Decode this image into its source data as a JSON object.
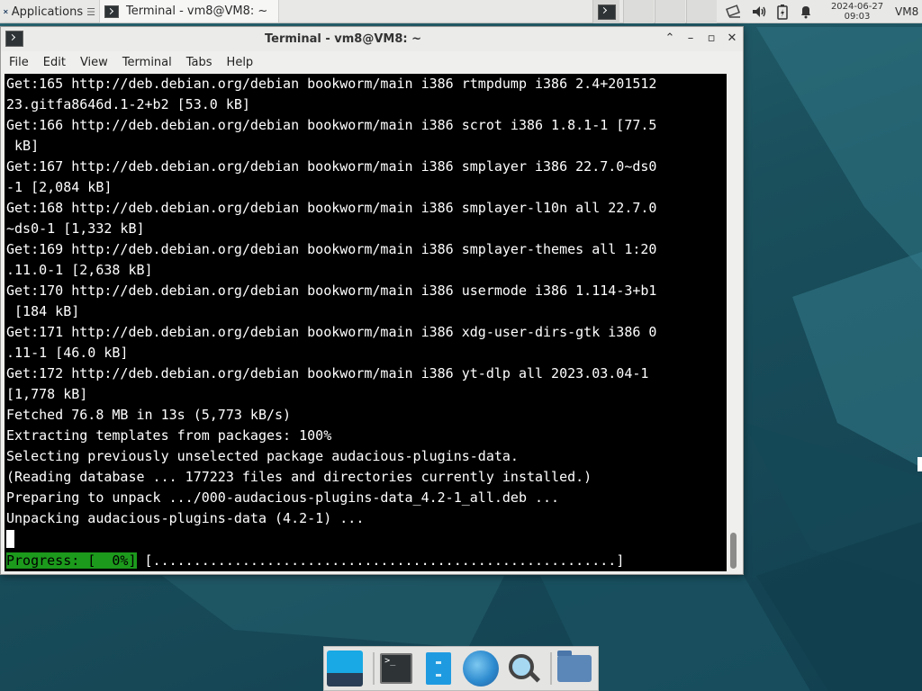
{
  "top_panel": {
    "applications_label": "Applications",
    "task_terminal_label": "Terminal - vm8@VM8: ~",
    "clock_date": "2024-06-27",
    "clock_time": "09:03",
    "user_label": "VM8",
    "tray_icons": [
      "network-icon",
      "volume-icon",
      "battery-icon",
      "notification-bell-icon"
    ]
  },
  "window": {
    "title": "Terminal - vm8@VM8: ~",
    "controls": {
      "shade": "⌃",
      "minimize": "–",
      "maximize": "▫",
      "close": "✕"
    }
  },
  "menubar": {
    "items": [
      "File",
      "Edit",
      "View",
      "Terminal",
      "Tabs",
      "Help"
    ]
  },
  "terminal": {
    "lines": [
      "Get:165 http://deb.debian.org/debian bookworm/main i386 rtmpdump i386 2.4+201512",
      "23.gitfa8646d.1-2+b2 [53.0 kB]",
      "Get:166 http://deb.debian.org/debian bookworm/main i386 scrot i386 1.8.1-1 [77.5",
      " kB]",
      "Get:167 http://deb.debian.org/debian bookworm/main i386 smplayer i386 22.7.0~ds0",
      "-1 [2,084 kB]",
      "Get:168 http://deb.debian.org/debian bookworm/main i386 smplayer-l10n all 22.7.0",
      "~ds0-1 [1,332 kB]",
      "Get:169 http://deb.debian.org/debian bookworm/main i386 smplayer-themes all 1:20",
      ".11.0-1 [2,638 kB]",
      "Get:170 http://deb.debian.org/debian bookworm/main i386 usermode i386 1.114-3+b1",
      " [184 kB]",
      "Get:171 http://deb.debian.org/debian bookworm/main i386 xdg-user-dirs-gtk i386 0",
      ".11-1 [46.0 kB]",
      "Get:172 http://deb.debian.org/debian bookworm/main i386 yt-dlp all 2023.03.04-1",
      "[1,778 kB]",
      "Fetched 76.8 MB in 13s (5,773 kB/s)",
      "Extracting templates from packages: 100%",
      "Selecting previously unselected package audacious-plugins-data.",
      "(Reading database ... 177223 files and directories currently installed.)",
      "Preparing to unpack .../000-audacious-plugins-data_4.2-1_all.deb ...",
      "Unpacking audacious-plugins-data (4.2-1) ..."
    ],
    "progress_label": "Progress: [  0%]",
    "progress_bar": " [.........................................................]",
    "progress_percent": 0
  },
  "dock": {
    "items": [
      "show-desktop",
      "terminal",
      "file-manager",
      "web-browser",
      "app-finder",
      "folder"
    ]
  },
  "colors": {
    "terminal_bg": "#000000",
    "terminal_fg": "#ffffff",
    "progress_green": "#1c9a1c",
    "panel_bg": "#e8e8e7",
    "desktop_teal": "#1d5561"
  }
}
